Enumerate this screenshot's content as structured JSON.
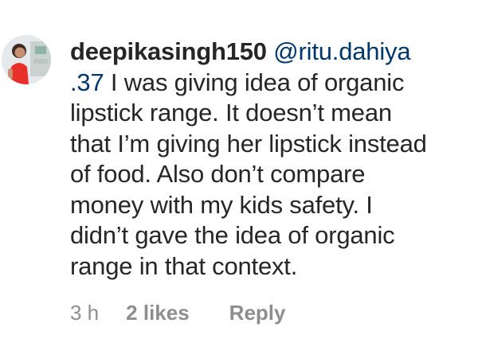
{
  "comment": {
    "username": "deepikasingh150",
    "mention": "@ritu.dahiya.37",
    "lines": [
      " I was giving idea of organic",
      "lipstick range. It doesn’t mean",
      "that I’m giving her lipstick instead",
      "of food. Also don’t compare",
      "money with my kids safety. I",
      "didn’t gave the idea of organic",
      "range in that context."
    ],
    "mention_part1": "@ritu.dahiya",
    "mention_part2": ".37",
    "time": "3 h",
    "likes": "2 likes",
    "reply_label": "Reply"
  },
  "icons": {
    "avatar": "profile-photo-icon"
  },
  "colors": {
    "text": "#262626",
    "mention": "#00376b",
    "meta": "#8e8e8e"
  }
}
